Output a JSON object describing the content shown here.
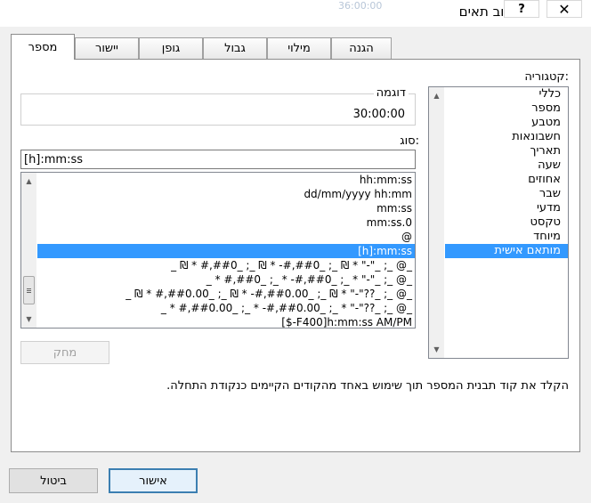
{
  "window": {
    "title": "עיצוב תאים",
    "help_label": "?",
    "close_label": "✕",
    "background_text": "36:00:00"
  },
  "tabs": [
    {
      "label": "מספר",
      "active": true
    },
    {
      "label": "יישור",
      "active": false
    },
    {
      "label": "גופן",
      "active": false
    },
    {
      "label": "גבול",
      "active": false
    },
    {
      "label": "מילוי",
      "active": false
    },
    {
      "label": "הגנה",
      "active": false
    }
  ],
  "category": {
    "label": "קטגוריה:",
    "items": [
      "כללי",
      "מספר",
      "מטבע",
      "חשבונאות",
      "תאריך",
      "שעה",
      "אחוזים",
      "שבר",
      "מדעי",
      "טקסט",
      "מיוחד",
      "מותאם אישית"
    ],
    "selected_index": 11
  },
  "sample": {
    "label": "דוגמה",
    "value": "30:00:00"
  },
  "type": {
    "label": "סוג:",
    "value": "[h]:mm:ss",
    "items": [
      "hh:mm:ss",
      "dd/mm/yyyy hh:mm",
      "mm:ss",
      "mm:ss.0",
      "@",
      "[h]:mm:ss",
      "_ ₪ * #,##0_ ;_ ₪ * -#,##0_ ;_ ₪ * \"-\"_ ;_ @_",
      "_ * #,##0_ ;_ * -#,##0_ ;_ * \"-\"_ ;_ @_",
      "_ ₪ * #,##0.00_ ;_ ₪ * -#,##0.00_ ;_ ₪ * \"-\"??_ ;_ @_",
      "_ * #,##0.00_ ;_ * -#,##0.00_ ;_ * \"-\"??_ ;_ @_",
      "[$-F400]h:mm:ss AM/PM"
    ],
    "selected_index": 5
  },
  "delete_label": "מחק",
  "description": "הקלד את קוד תבנית המספר תוך שימוש באחד מהקודים הקיימים כנקודת התחלה.",
  "ok_label": "אישור",
  "cancel_label": "ביטול"
}
